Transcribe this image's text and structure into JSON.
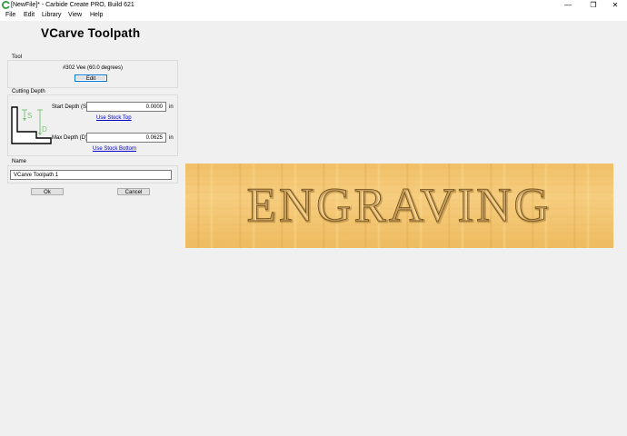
{
  "window": {
    "title": "[NewFile]* - Carbide Create PRO, Build 621",
    "minimize_glyph": "—",
    "maximize_glyph": "❐",
    "close_glyph": "✕"
  },
  "menu": {
    "items": [
      "File",
      "Edit",
      "Library",
      "View",
      "Help"
    ]
  },
  "panel": {
    "title": "VCarve Toolpath",
    "tool": {
      "group_label": "Tool",
      "name": "#302 Vee (60.0 degrees)",
      "edit_label": "Edit"
    },
    "cutting_depth": {
      "group_label": "Cutting Depth",
      "start_label": "Start Depth (S)",
      "start_value": "0.0000",
      "start_unit": "in",
      "use_stock_top": "Use Stock Top",
      "max_label": "Max Depth (D)",
      "max_value": "0.0625",
      "max_unit": "in",
      "use_stock_bottom": "Use Stock Bottom",
      "diagram_s": "S",
      "diagram_d": "D"
    },
    "name": {
      "group_label": "Name",
      "value": "VCarve Toolpath 1"
    },
    "ok_label": "Ok",
    "cancel_label": "Cancel"
  },
  "canvas": {
    "engraved_text": "ENGRAVING"
  },
  "colors": {
    "accent_green": "#7cc576",
    "wood": "#f2c46d",
    "link": "#0000cc"
  }
}
